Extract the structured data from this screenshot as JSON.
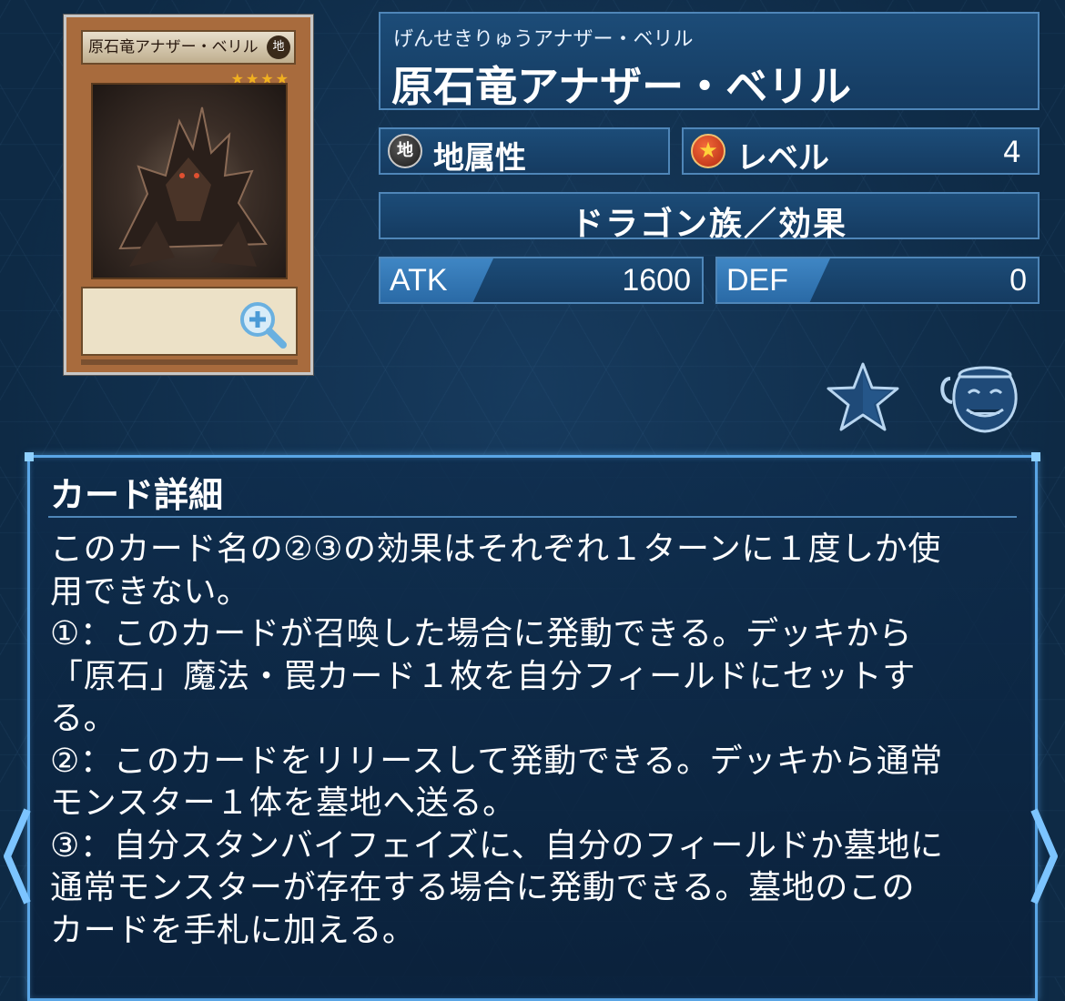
{
  "card": {
    "image_name": "原石竜アナザー・ベリル",
    "image_attribute": "地",
    "image_level_stars": "★★★★"
  },
  "name_ruby": "げんせきりゅうアナザー・ベリル",
  "name": "原石竜アナザー・ベリル",
  "attribute": {
    "icon_text": "地",
    "label": "地属性"
  },
  "level": {
    "label": "レベル",
    "value": "4"
  },
  "type_line": "ドラゴン族／効果",
  "stats": {
    "atk_label": "ATK",
    "atk_value": "1600",
    "def_label": "DEF",
    "def_value": "0"
  },
  "icons": {
    "zoom": "zoom-in-icon",
    "favorite": "star-icon",
    "pot": "pot-of-greed-icon",
    "prev": "chevron-left-icon",
    "next": "chevron-right-icon"
  },
  "detail": {
    "title": "カード詳細",
    "lines": [
      "このカード名の②③の効果はそれぞれ１ターンに１度しか使",
      "用できない。",
      "①：このカードが召喚した場合に発動できる。デッキから",
      "「原石」魔法・罠カード１枚を自分フィールドにセットす",
      "る。",
      "②：このカードをリリースして発動できる。デッキから通常",
      "モンスター１体を墓地へ送る。",
      "③：自分スタンバイフェイズに、自分のフィールドか墓地に",
      "通常モンスターが存在する場合に発動できる。墓地のこの",
      "カードを手札に加える。"
    ]
  },
  "colors": {
    "background": "#0e2a45",
    "panel": "#1c4c78",
    "panel_border": "#4f86b8",
    "accent": "#5aa6e6",
    "card_frame": "#a86b3d"
  }
}
